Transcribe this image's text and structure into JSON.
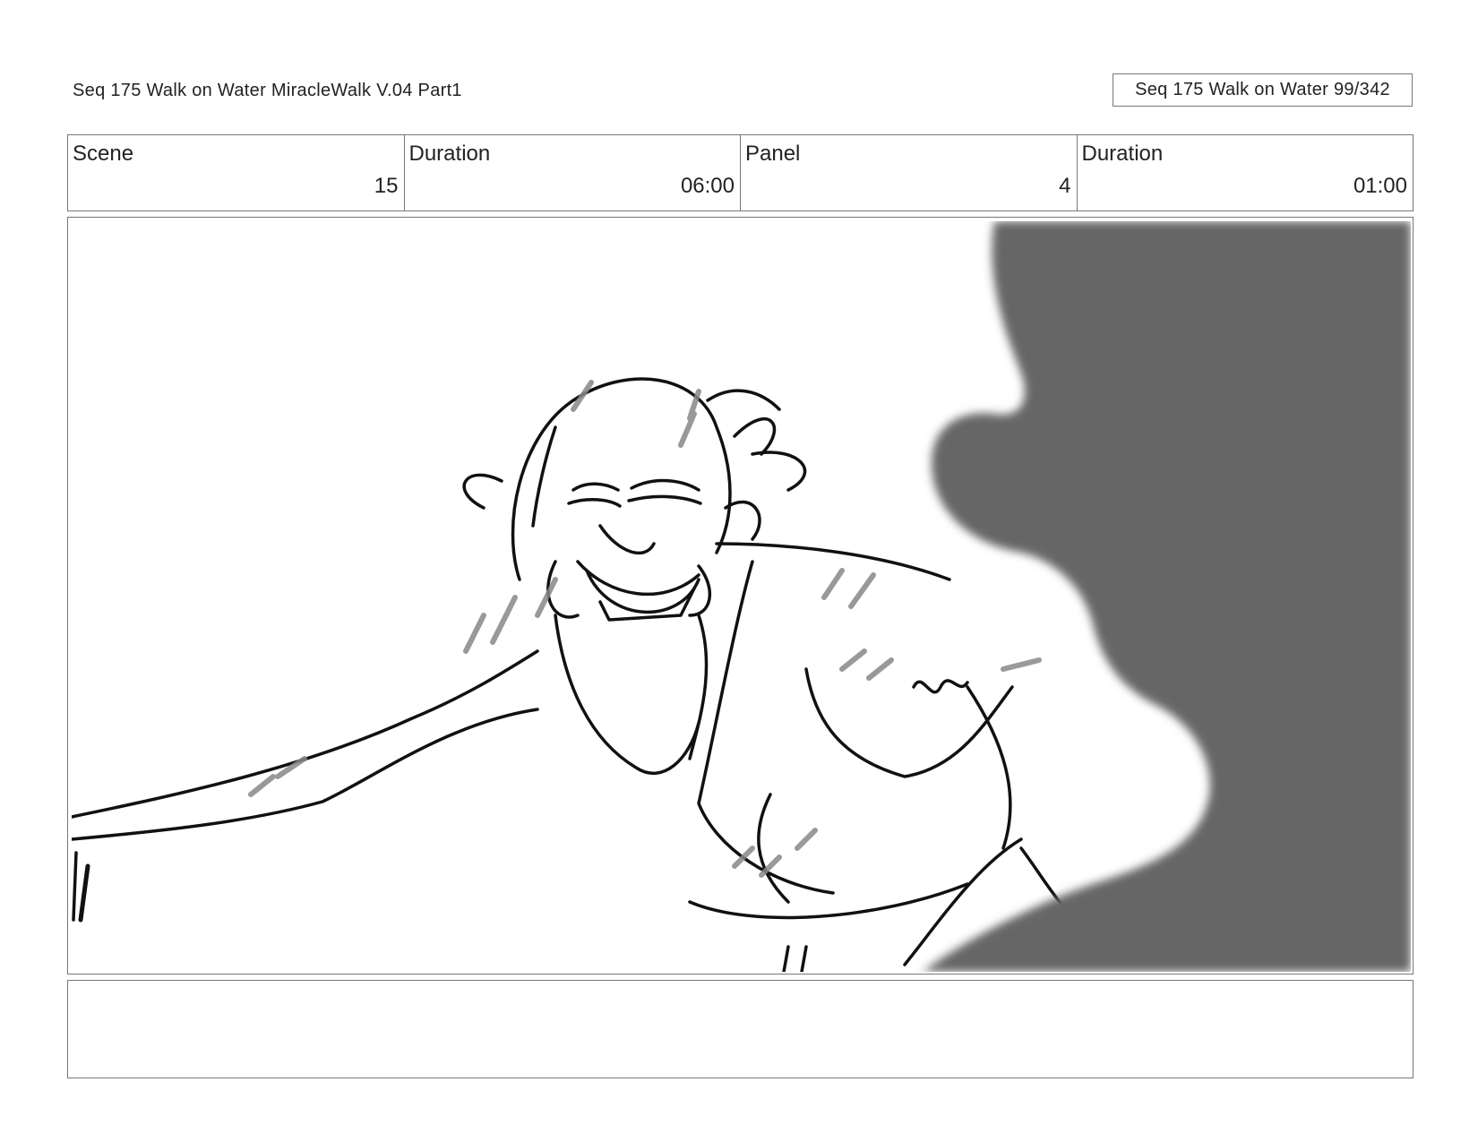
{
  "header": {
    "title": "Seq 175 Walk on Water  MiracleWalk V.04 Part1",
    "page_indicator": "Seq 175 Walk on Water  99/342"
  },
  "info": {
    "scene_label": "Scene",
    "scene_value": "15",
    "scene_duration_label": "Duration",
    "scene_duration_value": "06:00",
    "panel_label": "Panel",
    "panel_value": "4",
    "panel_duration_label": "Duration",
    "panel_duration_value": "01:00"
  },
  "notes": {
    "text": ""
  }
}
